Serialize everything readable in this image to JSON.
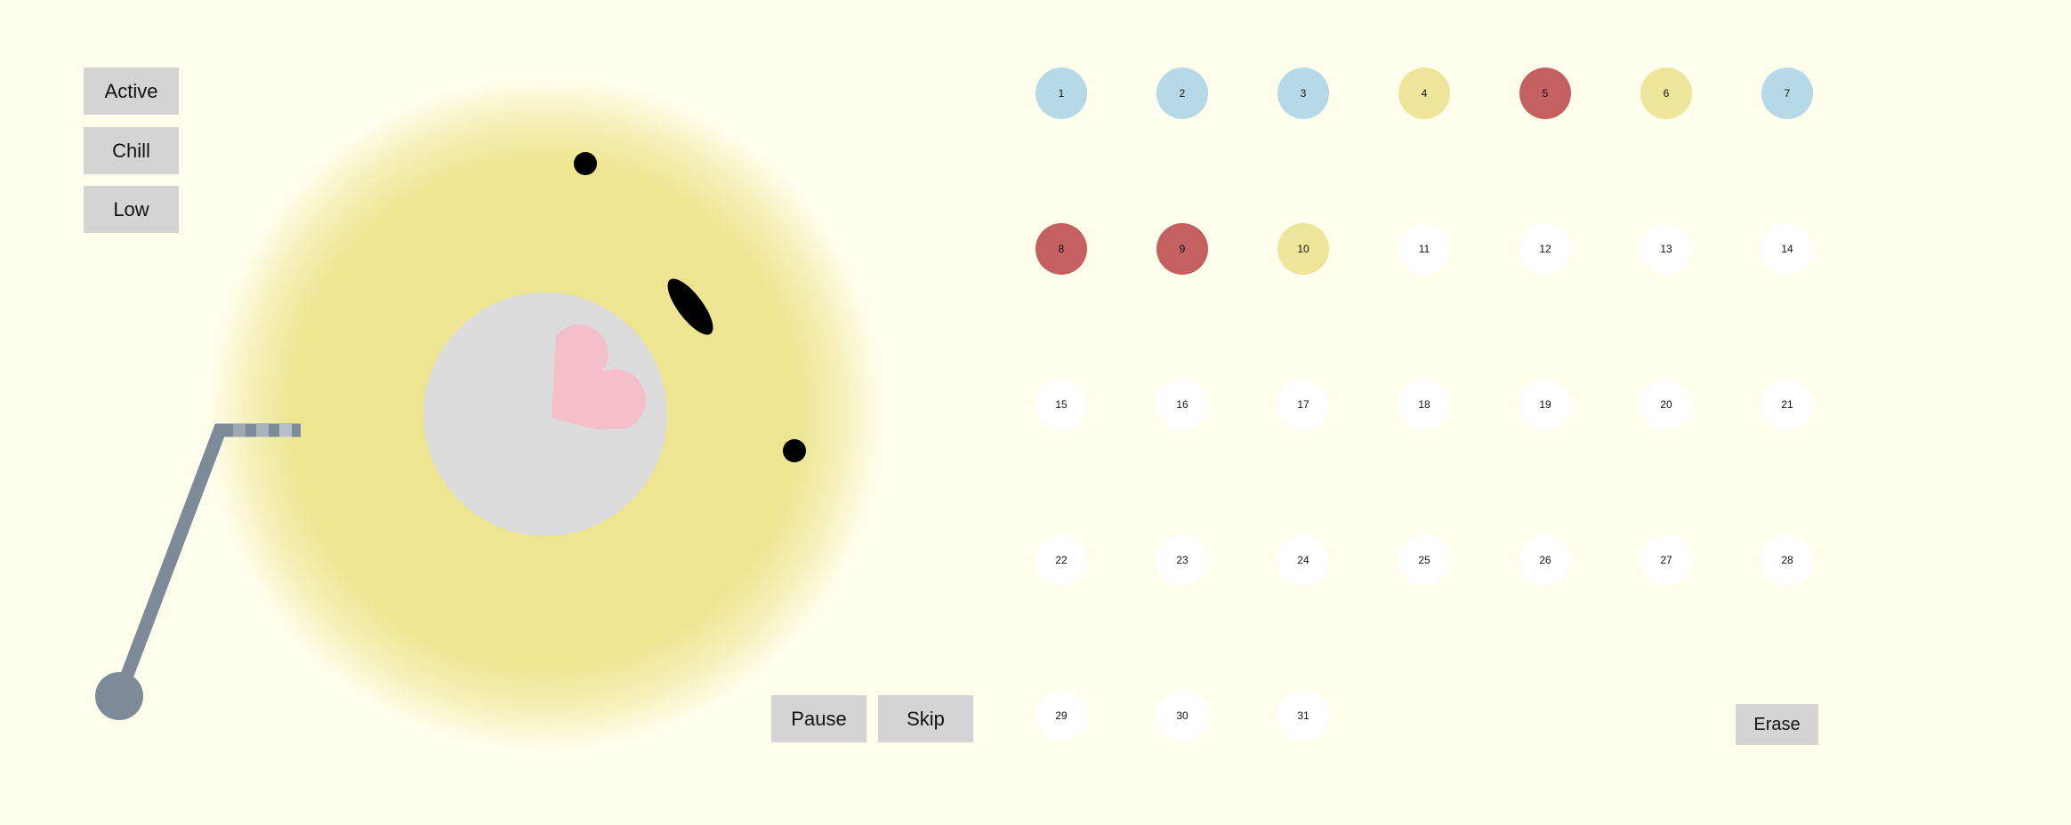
{
  "modes": [
    {
      "label": "Active"
    },
    {
      "label": "Chill"
    },
    {
      "label": "Low"
    }
  ],
  "controls": {
    "pause_label": "Pause",
    "skip_label": "Skip"
  },
  "calendar": {
    "erase_label": "Erase",
    "days": [
      {
        "label": "1",
        "state": "blue"
      },
      {
        "label": "2",
        "state": "blue"
      },
      {
        "label": "3",
        "state": "blue"
      },
      {
        "label": "4",
        "state": "yellow"
      },
      {
        "label": "5",
        "state": "red"
      },
      {
        "label": "6",
        "state": "yellow"
      },
      {
        "label": "7",
        "state": "blue"
      },
      {
        "label": "8",
        "state": "red"
      },
      {
        "label": "9",
        "state": "red"
      },
      {
        "label": "10",
        "state": "yellow"
      },
      {
        "label": "11",
        "state": "empty"
      },
      {
        "label": "12",
        "state": "empty"
      },
      {
        "label": "13",
        "state": "empty"
      },
      {
        "label": "14",
        "state": "empty"
      },
      {
        "label": "15",
        "state": "empty"
      },
      {
        "label": "16",
        "state": "empty"
      },
      {
        "label": "17",
        "state": "empty"
      },
      {
        "label": "18",
        "state": "empty"
      },
      {
        "label": "19",
        "state": "empty"
      },
      {
        "label": "20",
        "state": "empty"
      },
      {
        "label": "21",
        "state": "empty"
      },
      {
        "label": "22",
        "state": "empty"
      },
      {
        "label": "23",
        "state": "empty"
      },
      {
        "label": "24",
        "state": "empty"
      },
      {
        "label": "25",
        "state": "empty"
      },
      {
        "label": "26",
        "state": "empty"
      },
      {
        "label": "27",
        "state": "empty"
      },
      {
        "label": "28",
        "state": "empty"
      },
      {
        "label": "29",
        "state": "empty"
      },
      {
        "label": "30",
        "state": "empty"
      },
      {
        "label": "31",
        "state": "empty"
      }
    ]
  },
  "colors": {
    "background": "#fffeec",
    "disc": "#ede58f",
    "disc_center": "#dcdcdc",
    "heart": "#f5bfca",
    "tonearm": "#7d8b99",
    "button": "#d4d4d4",
    "blue": "#b5d9e6",
    "yellow": "#ede59a",
    "red": "#c4605f",
    "empty": "#ffffff"
  }
}
